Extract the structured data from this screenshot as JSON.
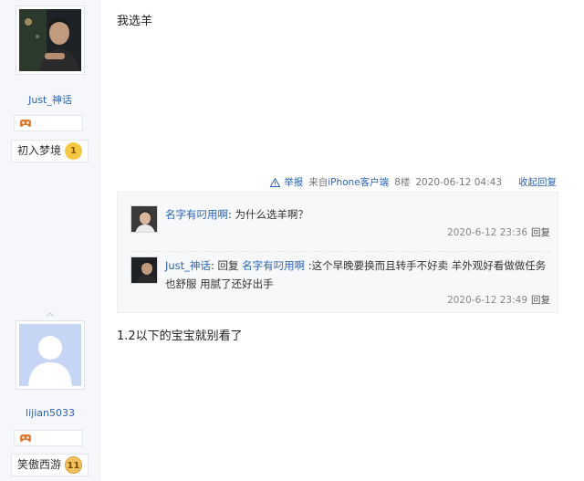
{
  "users": [
    {
      "name": "Just_神话",
      "level_title": "初入梦境",
      "level": "1",
      "avatar": "user-photo-avatar"
    },
    {
      "name": "lijian5033",
      "level_title": "笑傲西游",
      "level": "11",
      "avatar": "default-avatar"
    }
  ],
  "post1": {
    "text": "我选羊",
    "tail": {
      "report": "举报",
      "source_prefix": "来自",
      "source": "iPhone客户端",
      "floor": "8楼",
      "time": "2020-06-12 04:43",
      "toggle": "收起回复"
    },
    "replies": [
      {
        "author": "名字有叼用啊",
        "text": ": 为什么选羊啊？",
        "time": "2020-6-12 23:36",
        "reply_label": "回复"
      },
      {
        "author": "Just_神话",
        "reply_word": ": 回复 ",
        "reply_to": "名字有叼用啊",
        "text": " :这个早晚要换而且转手不好卖 羊外观好看做做任务也舒服 用腻了还好出手",
        "time": "2020-6-12 23:49",
        "reply_label": "回复"
      }
    ]
  },
  "post2": {
    "text": "1.2以下的宝宝就别看了"
  },
  "colors": {
    "link": "#2d64b3",
    "sidebar_bg": "#f5f7fa",
    "reply_bg": "#f7f8fa"
  }
}
